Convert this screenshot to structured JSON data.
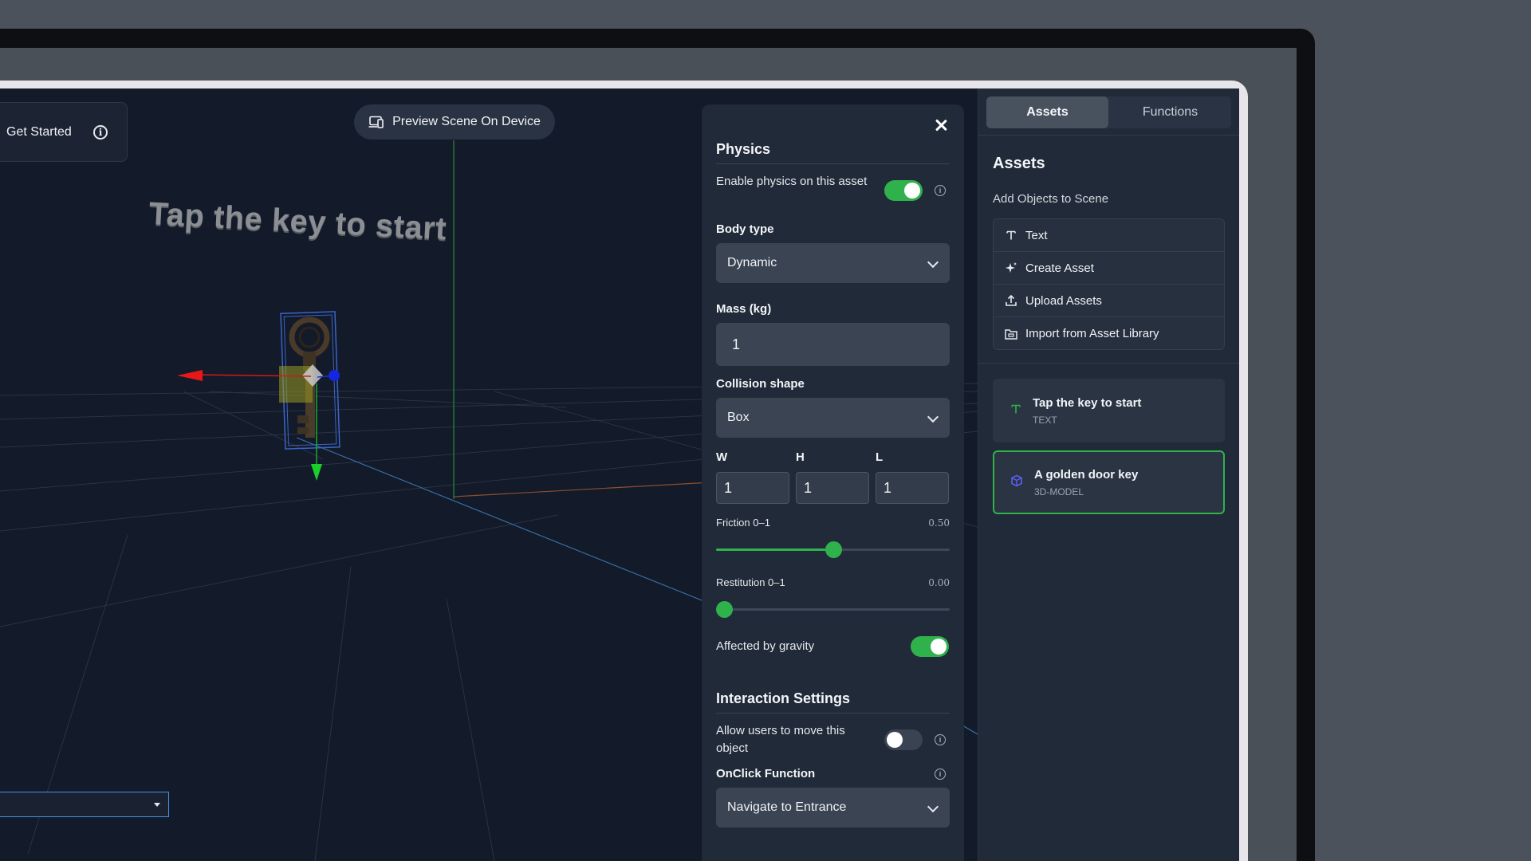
{
  "viewport": {
    "get_started_label": "Get Started",
    "preview_button_label": "Preview Scene On Device",
    "scene_text": "Tap the key to start"
  },
  "physics_panel": {
    "title": "Physics",
    "enable_physics_label": "Enable physics on this asset",
    "enable_physics_on": true,
    "body_type_label": "Body type",
    "body_type_value": "Dynamic",
    "mass_label": "Mass (kg)",
    "mass_value": "1",
    "collision_shape_label": "Collision shape",
    "collision_shape_value": "Box",
    "dimensions": {
      "w_label": "W",
      "w_value": "1",
      "h_label": "H",
      "h_value": "1",
      "l_label": "L",
      "l_value": "1"
    },
    "friction_label": "Friction 0–1",
    "friction_value_text": "0.50",
    "friction_value": 0.5,
    "restitution_label": "Restitution 0–1",
    "restitution_value_text": "0.00",
    "restitution_value": 0.0,
    "gravity_label": "Affected by gravity",
    "gravity_on": true
  },
  "interaction_panel": {
    "title": "Interaction Settings",
    "allow_move_label": "Allow users to move this object",
    "allow_move_on": false,
    "onclick_label": "OnClick Function",
    "onclick_value": "Navigate to Entrance"
  },
  "sidebar": {
    "tabs": [
      {
        "label": "Assets",
        "active": true
      },
      {
        "label": "Functions",
        "active": false
      }
    ],
    "title": "Assets",
    "subtitle": "Add Objects to Scene",
    "add_items": [
      {
        "label": "Text",
        "icon": "text-icon"
      },
      {
        "label": "Create Asset",
        "icon": "sparkle-icon"
      },
      {
        "label": "Upload Assets",
        "icon": "upload-icon"
      },
      {
        "label": "Import from Asset Library",
        "icon": "folder-icon"
      }
    ],
    "objects": [
      {
        "name": "Tap the key to start",
        "type": "TEXT",
        "icon": "text-icon",
        "selected": false
      },
      {
        "name": "A golden door key",
        "type": "3D-MODEL",
        "icon": "cube-icon",
        "selected": true
      }
    ]
  },
  "colors": {
    "accent_green": "#2fb24b",
    "panel_bg": "#212a38",
    "viewport_bg": "#131a29"
  }
}
